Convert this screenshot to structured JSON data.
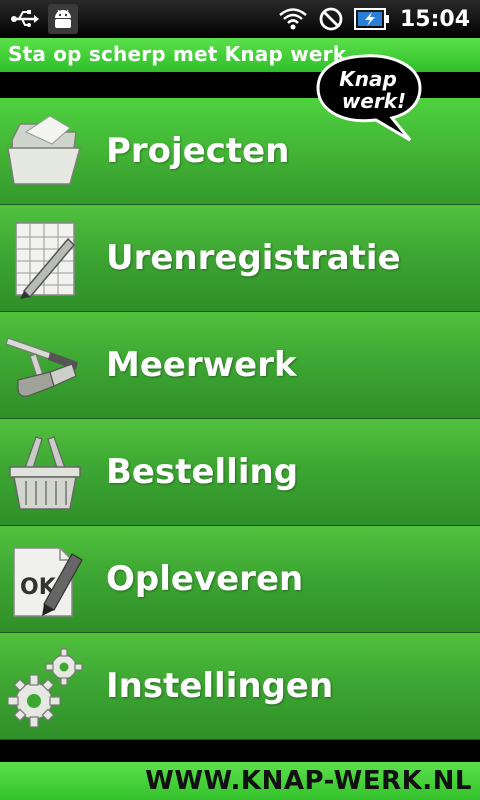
{
  "status_bar": {
    "left_icons": [
      "usb-icon",
      "android-debug-icon"
    ],
    "right_icons": [
      "wifi-icon",
      "no-signal-icon",
      "battery-charging-icon"
    ],
    "time": "15:04"
  },
  "title_bar": {
    "text": "Sta op scherp met Knap werk"
  },
  "logo": {
    "line1": "Knap",
    "line2": "werk!"
  },
  "menu": {
    "items": [
      {
        "label": "Projecten",
        "icon": "folder-icon"
      },
      {
        "label": "Urenregistratie",
        "icon": "timesheet-pen-icon"
      },
      {
        "label": "Meerwerk",
        "icon": "tools-icon"
      },
      {
        "label": "Bestelling",
        "icon": "basket-icon"
      },
      {
        "label": "Opleveren",
        "icon": "ok-document-icon"
      },
      {
        "label": "Instellingen",
        "icon": "gears-icon"
      }
    ]
  },
  "footer": {
    "text": "WWW.KNAP-WERK.NL"
  },
  "colors": {
    "green": "#3ea733",
    "title_green": "#5be04a",
    "text": "#ffffff"
  }
}
